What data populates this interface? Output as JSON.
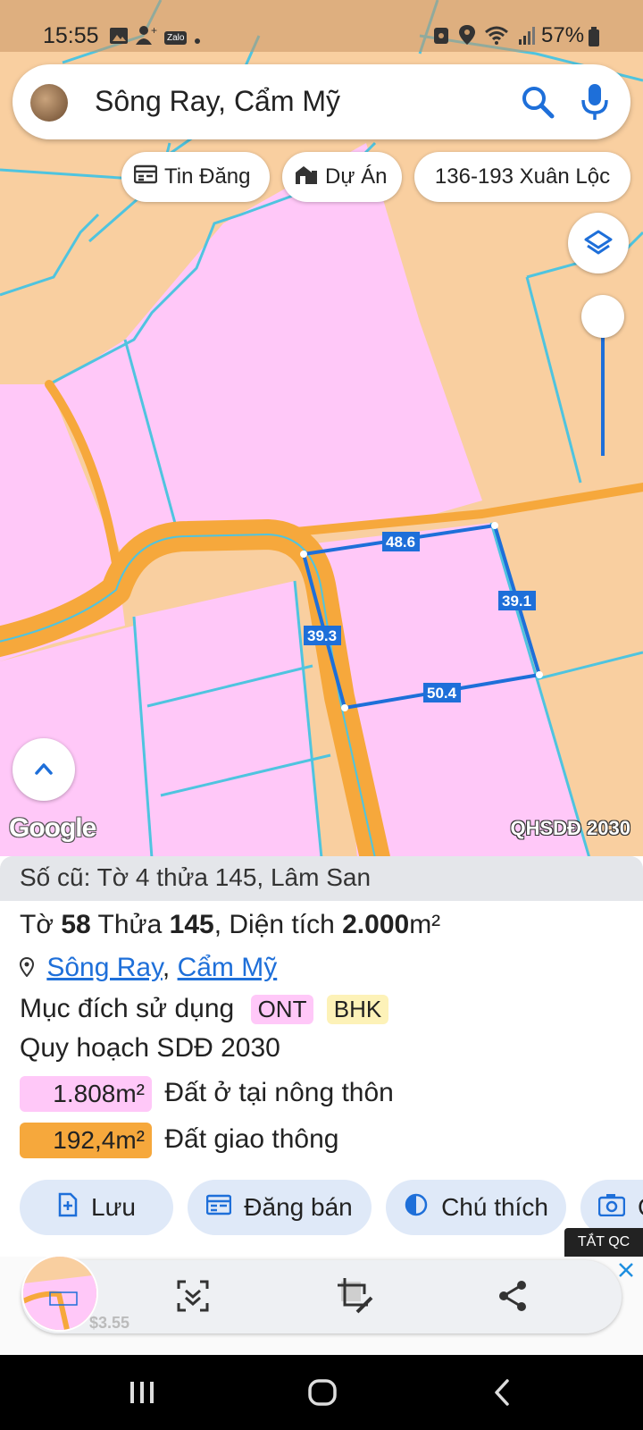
{
  "status_bar": {
    "time": "15:55",
    "battery": "57%",
    "notification_icons": [
      "image-icon",
      "contact-add-icon",
      "zalo-icon",
      "dot-icon"
    ],
    "zalo_text": "Zalo",
    "system_icons": [
      "screen-record-icon",
      "location-icon",
      "wifi-icon",
      "signal-icon",
      "battery-icon"
    ]
  },
  "search": {
    "query": "Sông Ray, Cẩm Mỹ"
  },
  "chips": {
    "listings": "Tin Đăng",
    "projects": "Dự Án",
    "address": "136-193 Xuân Lộc"
  },
  "map": {
    "google_logo": "Google",
    "layer_label": "QHSDĐ 2030",
    "edge_labels": [
      "48.6",
      "39.1",
      "50.4",
      "39.3"
    ],
    "colors": {
      "residential": "#ffc8f8",
      "agricultural": "#f9cfa0",
      "road": "#f6a83c",
      "parcel_lines": "#4fc4df",
      "selected": "#1e6fd9"
    }
  },
  "parcel": {
    "old_ref": "Số cũ: Tờ 4 thửa 145, Lâm San",
    "sheet_label": "Tờ",
    "sheet_no": "58",
    "plot_label": "Thửa",
    "plot_no": "145",
    "area_label": ", Diện tích",
    "area_value": "2.000",
    "area_unit": "m²",
    "location_commune": "Sông Ray",
    "location_sep": ",",
    "location_district": "Cẩm Mỹ",
    "usage_label": "Mục đích sử dụng",
    "usage_tags": [
      "ONT",
      "BHK"
    ],
    "plan_label": "Quy hoạch SDĐ 2030",
    "plan_rows": [
      {
        "area": "1.808m²",
        "name": "Đất ở tại nông thôn",
        "color": "#ffc8f8"
      },
      {
        "area": "192,4m²",
        "name": "Đất giao thông",
        "color": "#f6a83c"
      }
    ]
  },
  "actions": {
    "save": "Lưu",
    "post_sale": "Đăng bán",
    "legend": "Chú thích",
    "camera": "C"
  },
  "ad": {
    "close_ads": "TẮT QC",
    "price": "$3.55"
  }
}
